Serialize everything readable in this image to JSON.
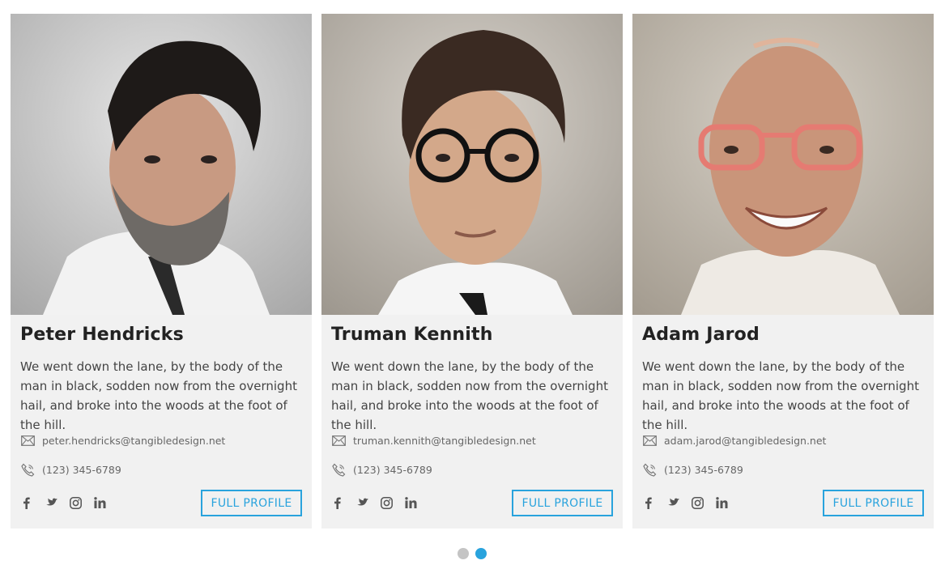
{
  "members": [
    {
      "name": "Peter Hendricks",
      "bio": "We went down the lane, by the body of the man in black, sodden now from the overnight hail, and broke into the woods at the foot of the hill.",
      "email": "peter.hendricks@tangibledesign.net",
      "phone": "(123) 345-6789",
      "button": "FULL PROFILE"
    },
    {
      "name": "Truman Kennith",
      "bio": "We went down the lane, by the body of the man in black, sodden now from the overnight hail, and broke into the woods at the foot of the hill.",
      "email": "truman.kennith@tangibledesign.net",
      "phone": "(123) 345-6789",
      "button": "FULL PROFILE"
    },
    {
      "name": "Adam Jarod",
      "bio": "We went down the lane, by the body of the man in black, sodden now from the overnight hail, and broke into the woods at the foot of the hill.",
      "email": "adam.jarod@tangibledesign.net",
      "phone": "(123) 345-6789",
      "button": "FULL PROFILE"
    }
  ],
  "social_icons": [
    "facebook-icon",
    "twitter-icon",
    "instagram-icon",
    "linkedin-icon"
  ],
  "pagination": {
    "total": 2,
    "active": 2
  },
  "colors": {
    "accent": "#29a3dd",
    "card_bg": "#f1f1f1",
    "dot_inactive": "#c4c4c4"
  }
}
